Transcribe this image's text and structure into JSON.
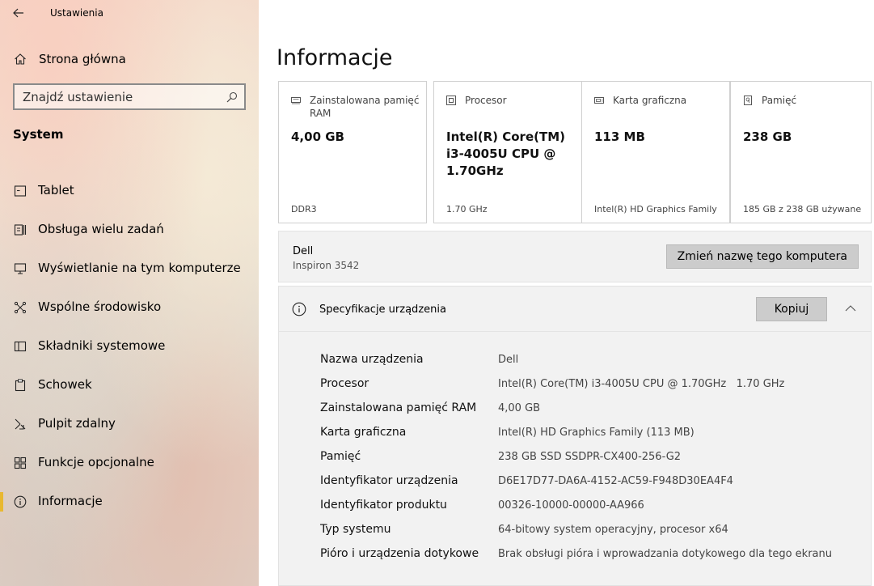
{
  "window": {
    "title": "Ustawienia"
  },
  "sidebar": {
    "home_label": "Strona główna",
    "search_placeholder": "Znajdź ustawienie",
    "section_title": "System",
    "items": [
      {
        "label": "Tablet",
        "icon": "tablet-icon"
      },
      {
        "label": "Obsługa wielu zadań",
        "icon": "multitasking-icon"
      },
      {
        "label": "Wyświetlanie na tym komputerze",
        "icon": "projecting-icon"
      },
      {
        "label": "Wspólne środowisko",
        "icon": "shared-experiences-icon"
      },
      {
        "label": "Składniki systemowe",
        "icon": "system-components-icon"
      },
      {
        "label": "Schowek",
        "icon": "clipboard-icon"
      },
      {
        "label": "Pulpit zdalny",
        "icon": "remote-desktop-icon"
      },
      {
        "label": "Funkcje opcjonalne",
        "icon": "optional-features-icon"
      },
      {
        "label": "Informacje",
        "icon": "info-icon",
        "active": true
      }
    ],
    "accent_color": "#e8b830"
  },
  "main": {
    "title": "Informacje",
    "cards": [
      {
        "caption": "Zainstalowana pamięć RAM",
        "value": "4,00 GB",
        "sub": "DDR3",
        "icon": "ram-icon"
      },
      {
        "caption": "Procesor",
        "value": "Intel(R) Core(TM) i3-4005U CPU @ 1.70GHz",
        "sub": "1.70 GHz",
        "icon": "processor-icon"
      },
      {
        "caption": "Karta graficzna",
        "value": "113 MB",
        "sub": "Intel(R) HD Graphics Family",
        "icon": "graphics-card-icon"
      },
      {
        "caption": "Pamięć",
        "value": "238 GB",
        "sub": "185 GB z 238 GB używane",
        "icon": "storage-icon"
      }
    ],
    "device": {
      "name": "Dell",
      "model": "Inspiron 3542",
      "rename_label": "Zmień nazwę tego komputera"
    },
    "spec": {
      "title": "Specyfikacje urządzenia",
      "copy_label": "Kopiuj",
      "rows": [
        {
          "key": "Nazwa urządzenia",
          "value": "Dell"
        },
        {
          "key": "Procesor",
          "value": "Intel(R) Core(TM) i3-4005U CPU @ 1.70GHz   1.70 GHz"
        },
        {
          "key": "Zainstalowana pamięć RAM",
          "value": "4,00 GB"
        },
        {
          "key": "Karta graficzna",
          "value": "Intel(R) HD Graphics Family (113 MB)"
        },
        {
          "key": "Pamięć",
          "value": "238 GB SSD SSDPR-CX400-256-G2"
        },
        {
          "key": "Identyfikator urządzenia",
          "value": "D6E17D77-DA6A-4152-AC59-F948D30EA4F4"
        },
        {
          "key": "Identyfikator produktu",
          "value": "00326-10000-00000-AA966"
        },
        {
          "key": "Typ systemu",
          "value": "64-bitowy system operacyjny, procesor x64"
        },
        {
          "key": "Pióro i urządzenia dotykowe",
          "value": "Brak obsługi pióra i wprowadzania dotykowego dla tego ekranu"
        }
      ]
    }
  }
}
